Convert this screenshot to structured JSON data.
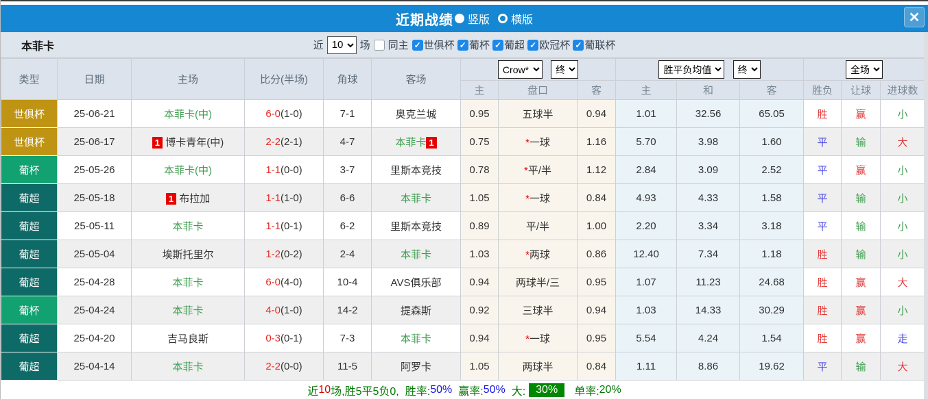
{
  "title_bar": {
    "title": "近期战绩",
    "radio_vertical": "竖版",
    "radio_horizontal": "横版",
    "close_glyph": "✕"
  },
  "filter_bar": {
    "team_name": "本菲卡",
    "near_label": "近",
    "count_value": "10",
    "games_label": "场",
    "same_home_label": "同主",
    "check_glyph": "✓",
    "leagues": [
      {
        "label": "世俱杯"
      },
      {
        "label": "葡杯"
      },
      {
        "label": "葡超"
      },
      {
        "label": "欧冠杯"
      },
      {
        "label": "葡联杯"
      }
    ]
  },
  "table": {
    "headers": {
      "type": "类型",
      "date": "日期",
      "home": "主场",
      "score": "比分(半场)",
      "corner": "角球",
      "away": "客场",
      "sub_h_home": "主",
      "sub_h_line": "盘口",
      "sub_h_away": "客",
      "sub_a_home": "主",
      "sub_a_draw": "和",
      "sub_a_away": "客",
      "sub_wdl": "胜负",
      "sub_hcp": "让球",
      "sub_goal": "进球数"
    },
    "selects": {
      "company": "Crow*",
      "time1": "终",
      "avg": "胜平负均值",
      "time2": "终",
      "scope": "全场"
    },
    "rows": [
      {
        "type": "世俱杯",
        "type_class": "t-wc",
        "date": "25-06-21",
        "home_badge": "",
        "home": "本菲卡(中)",
        "home_class": "self",
        "score": "6-0",
        "half": "(1-0)",
        "corner": "7-1",
        "away": "奥克兰城",
        "away_class": "",
        "away_badge": "",
        "h_home": "0.95",
        "h_star": "",
        "h_line": "五球半",
        "h_away": "0.94",
        "a_home": "1.01",
        "a_draw": "32.56",
        "a_away": "65.05",
        "r_wdl": "胜",
        "r_wdl_class": "c-red",
        "r_hcp": "赢",
        "r_hcp_class": "c-red",
        "r_goal": "小",
        "r_goal_class": "c-green"
      },
      {
        "type": "世俱杯",
        "type_class": "t-wc",
        "date": "25-06-17",
        "home_badge": "1",
        "home": "博卡青年(中)",
        "home_class": "",
        "score": "2-2",
        "half": "(2-1)",
        "corner": "4-7",
        "away": "本菲卡",
        "away_class": "self",
        "away_badge": "1",
        "h_home": "0.75",
        "h_star": "*",
        "h_line": "一球",
        "h_away": "1.16",
        "a_home": "5.70",
        "a_draw": "3.98",
        "a_away": "1.60",
        "r_wdl": "平",
        "r_wdl_class": "c-blue",
        "r_hcp": "输",
        "r_hcp_class": "c-green",
        "r_goal": "大",
        "r_goal_class": "c-red"
      },
      {
        "type": "葡杯",
        "type_class": "t-cup",
        "date": "25-05-26",
        "home_badge": "",
        "home": "本菲卡(中)",
        "home_class": "self",
        "score": "1-1",
        "half": "(0-0)",
        "corner": "3-7",
        "away": "里斯本竞技",
        "away_class": "",
        "away_badge": "",
        "h_home": "0.78",
        "h_star": "*",
        "h_line": "平/半",
        "h_away": "1.12",
        "a_home": "2.84",
        "a_draw": "3.09",
        "a_away": "2.52",
        "r_wdl": "平",
        "r_wdl_class": "c-blue",
        "r_hcp": "赢",
        "r_hcp_class": "c-red",
        "r_goal": "小",
        "r_goal_class": "c-green"
      },
      {
        "type": "葡超",
        "type_class": "t-liga",
        "date": "25-05-18",
        "home_badge": "1",
        "home": "布拉加",
        "home_class": "",
        "score": "1-1",
        "half": "(1-0)",
        "corner": "6-6",
        "away": "本菲卡",
        "away_class": "self",
        "away_badge": "",
        "h_home": "1.05",
        "h_star": "*",
        "h_line": "一球",
        "h_away": "0.84",
        "a_home": "4.93",
        "a_draw": "4.33",
        "a_away": "1.58",
        "r_wdl": "平",
        "r_wdl_class": "c-blue",
        "r_hcp": "输",
        "r_hcp_class": "c-green",
        "r_goal": "小",
        "r_goal_class": "c-green"
      },
      {
        "type": "葡超",
        "type_class": "t-liga",
        "date": "25-05-11",
        "home_badge": "",
        "home": "本菲卡",
        "home_class": "self",
        "score": "1-1",
        "half": "(0-1)",
        "corner": "6-2",
        "away": "里斯本竞技",
        "away_class": "",
        "away_badge": "",
        "h_home": "0.89",
        "h_star": "",
        "h_line": "平/半",
        "h_away": "1.00",
        "a_home": "2.20",
        "a_draw": "3.34",
        "a_away": "3.18",
        "r_wdl": "平",
        "r_wdl_class": "c-blue",
        "r_hcp": "输",
        "r_hcp_class": "c-green",
        "r_goal": "小",
        "r_goal_class": "c-green"
      },
      {
        "type": "葡超",
        "type_class": "t-liga",
        "date": "25-05-04",
        "home_badge": "",
        "home": "埃斯托里尔",
        "home_class": "",
        "score": "1-2",
        "half": "(0-2)",
        "corner": "2-4",
        "away": "本菲卡",
        "away_class": "self",
        "away_badge": "",
        "h_home": "1.03",
        "h_star": "*",
        "h_line": "两球",
        "h_away": "0.86",
        "a_home": "12.40",
        "a_draw": "7.34",
        "a_away": "1.18",
        "r_wdl": "胜",
        "r_wdl_class": "c-red",
        "r_hcp": "输",
        "r_hcp_class": "c-green",
        "r_goal": "小",
        "r_goal_class": "c-green"
      },
      {
        "type": "葡超",
        "type_class": "t-liga",
        "date": "25-04-28",
        "home_badge": "",
        "home": "本菲卡",
        "home_class": "self",
        "score": "6-0",
        "half": "(4-0)",
        "corner": "10-4",
        "away": "AVS俱乐部",
        "away_class": "",
        "away_badge": "",
        "h_home": "0.94",
        "h_star": "",
        "h_line": "两球半/三",
        "h_away": "0.95",
        "a_home": "1.07",
        "a_draw": "11.23",
        "a_away": "24.68",
        "r_wdl": "胜",
        "r_wdl_class": "c-red",
        "r_hcp": "赢",
        "r_hcp_class": "c-red",
        "r_goal": "大",
        "r_goal_class": "c-red"
      },
      {
        "type": "葡杯",
        "type_class": "t-cup",
        "date": "25-04-24",
        "home_badge": "",
        "home": "本菲卡",
        "home_class": "self",
        "score": "4-0",
        "half": "(1-0)",
        "corner": "14-2",
        "away": "提森斯",
        "away_class": "",
        "away_badge": "",
        "h_home": "0.92",
        "h_star": "",
        "h_line": "三球半",
        "h_away": "0.94",
        "a_home": "1.03",
        "a_draw": "14.33",
        "a_away": "30.29",
        "r_wdl": "胜",
        "r_wdl_class": "c-red",
        "r_hcp": "赢",
        "r_hcp_class": "c-red",
        "r_goal": "小",
        "r_goal_class": "c-green"
      },
      {
        "type": "葡超",
        "type_class": "t-liga",
        "date": "25-04-20",
        "home_badge": "",
        "home": "吉马良斯",
        "home_class": "",
        "score": "0-3",
        "half": "(0-1)",
        "corner": "7-3",
        "away": "本菲卡",
        "away_class": "self",
        "away_badge": "",
        "h_home": "0.94",
        "h_star": "*",
        "h_line": "一球",
        "h_away": "0.95",
        "a_home": "5.54",
        "a_draw": "4.24",
        "a_away": "1.54",
        "r_wdl": "胜",
        "r_wdl_class": "c-red",
        "r_hcp": "赢",
        "r_hcp_class": "c-red",
        "r_goal": "走",
        "r_goal_class": "c-blue"
      },
      {
        "type": "葡超",
        "type_class": "t-liga",
        "date": "25-04-14",
        "home_badge": "",
        "home": "本菲卡",
        "home_class": "self",
        "score": "2-2",
        "half": "(0-0)",
        "corner": "11-5",
        "away": "阿罗卡",
        "away_class": "",
        "away_badge": "",
        "h_home": "1.05",
        "h_star": "",
        "h_line": "两球半",
        "h_away": "0.84",
        "a_home": "1.11",
        "a_draw": "8.86",
        "a_away": "19.62",
        "r_wdl": "平",
        "r_wdl_class": "c-blue",
        "r_hcp": "输",
        "r_hcp_class": "c-green",
        "r_goal": "大",
        "r_goal_class": "c-red"
      }
    ]
  },
  "footer": {
    "near": "近",
    "count": "10",
    "record": "场,胜5平5负0,",
    "win_rate_label": "胜率:",
    "win_rate": "50%",
    "handicap_rate_label": "赢率:",
    "handicap_rate": "50%",
    "big_label": "大:",
    "big_rate": "30%",
    "single_rate_label": "单率:",
    "single_rate": "20%"
  },
  "colors": {
    "titlebar_blue": "#1687d2",
    "checkbox_blue": "#1d88e8",
    "worldcup_gold": "#bf9414",
    "cup_green": "#12a170",
    "liga_teal": "#0e6a66",
    "self_team_green": "#3e9e4f",
    "score_red": "#e8251f",
    "result_blue": "#4a4ae0",
    "highlight_green_bg": "#008800",
    "handicap_col_bg": "#faf5ec",
    "avg_col_bg": "#e9f3f8"
  }
}
